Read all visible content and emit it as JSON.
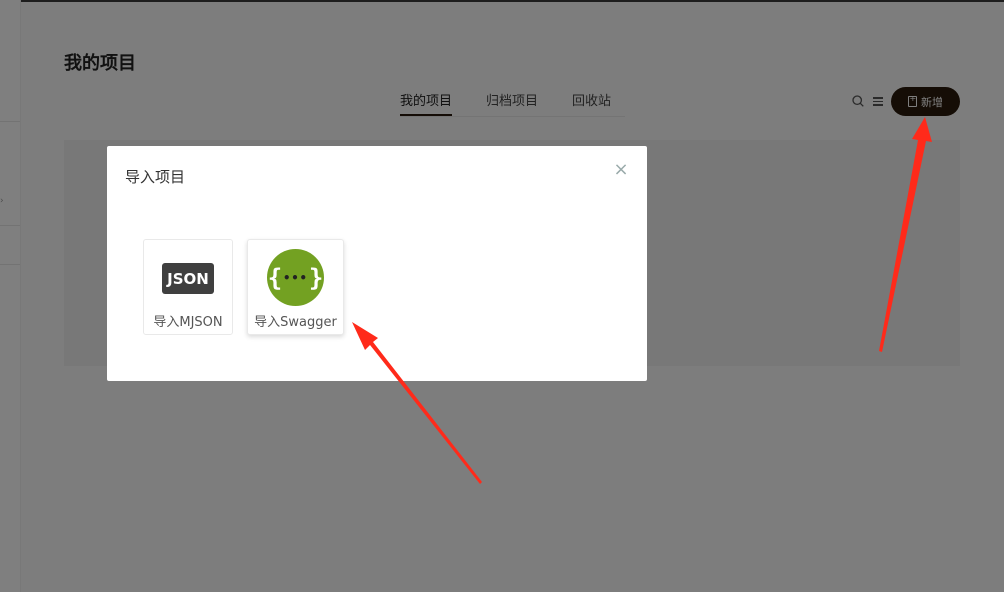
{
  "page": {
    "title": "我的项目",
    "tabs": [
      {
        "label": "我的项目",
        "active": true
      },
      {
        "label": "归档项目",
        "active": false
      },
      {
        "label": "回收站",
        "active": false
      }
    ],
    "toolbar": {
      "search_icon": "search-icon",
      "menu_icon": "list-icon",
      "new_label": "新增"
    }
  },
  "modal": {
    "title": "导入项目",
    "close_glyph": "×",
    "cards": [
      {
        "label": "导入MJSON",
        "logo_text": "JSON",
        "icon": "json-icon"
      },
      {
        "label": "导入Swagger",
        "logo_left": "{",
        "logo_right": "}",
        "logo_dots": "•••",
        "icon": "swagger-icon"
      }
    ]
  },
  "colors": {
    "accent": "#2b1b0c",
    "swagger_green": "#73a122",
    "annotation_red": "#ff2a1a"
  }
}
